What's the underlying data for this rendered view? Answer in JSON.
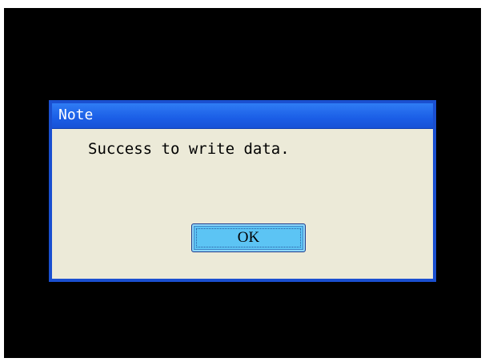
{
  "dialog": {
    "title": "Note",
    "message": "Success to write data.",
    "ok_label": "OK"
  },
  "colors": {
    "background": "#000000",
    "titlebar": "#1b5ee6",
    "dialog_body": "#ecead8",
    "button": "#5cc4f4"
  }
}
